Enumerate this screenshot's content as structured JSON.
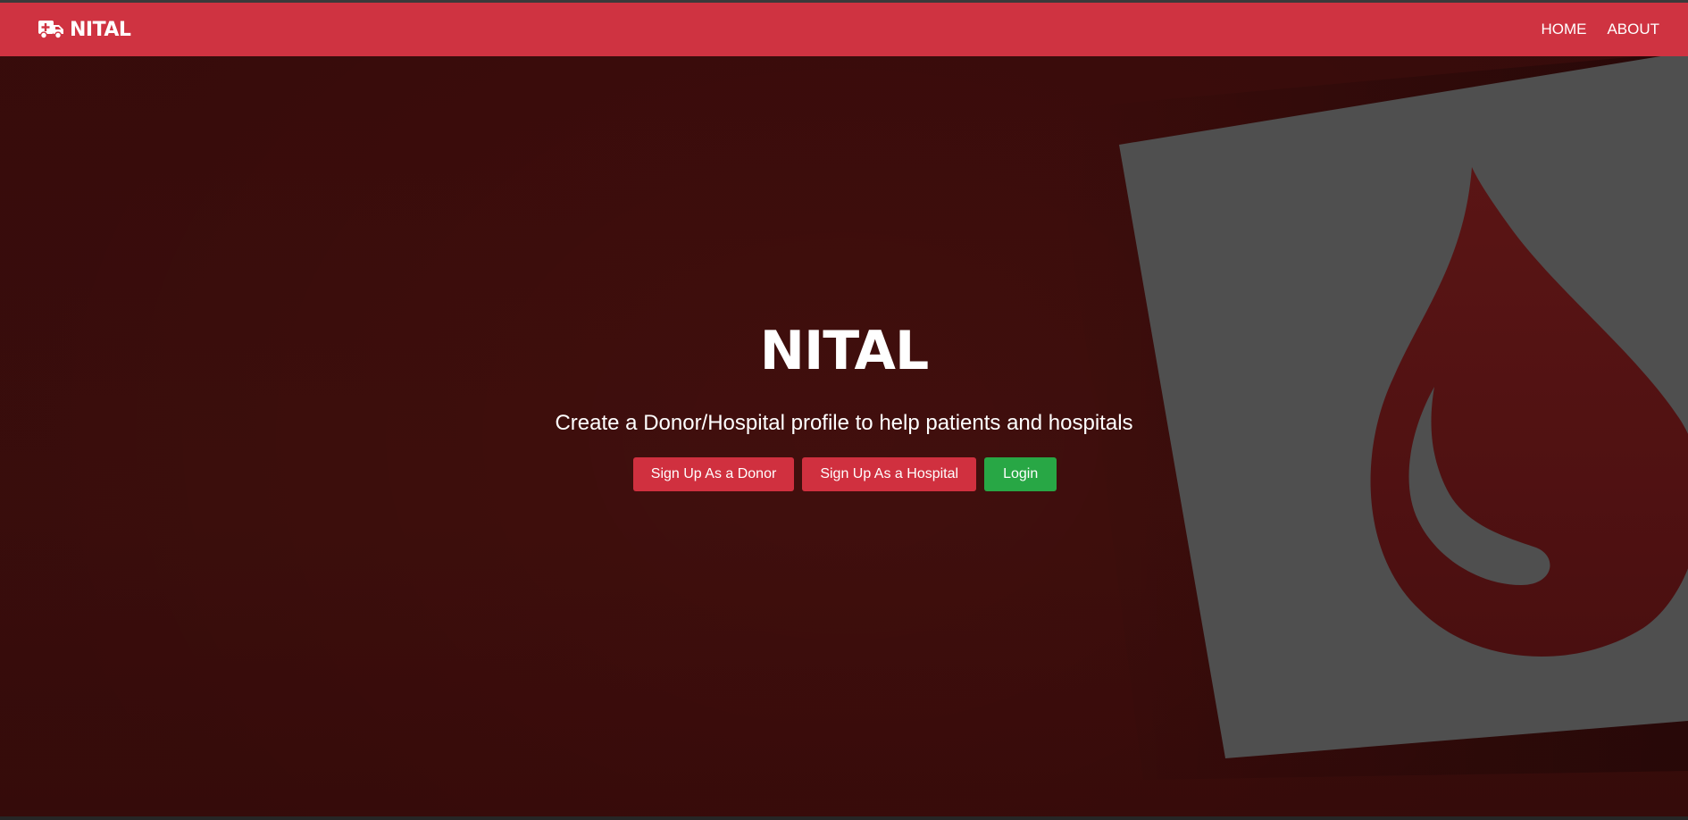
{
  "navbar": {
    "brand_icon": "ambulance-icon",
    "brand_text": "NITAL",
    "links": [
      {
        "label": "HOME"
      },
      {
        "label": "ABOUT"
      }
    ],
    "background": "#cf3341"
  },
  "hero": {
    "title": "NITAL",
    "subtitle": "Create a Donor/Hospital profile to help patients and hospitals",
    "background_image": "blood-drop-illustration",
    "buttons": [
      {
        "label": "Sign Up As a Donor",
        "color": "#d0303f"
      },
      {
        "label": "Sign Up As a Hospital",
        "color": "#d0303f"
      },
      {
        "label": "Login",
        "color": "#28a745"
      }
    ]
  }
}
